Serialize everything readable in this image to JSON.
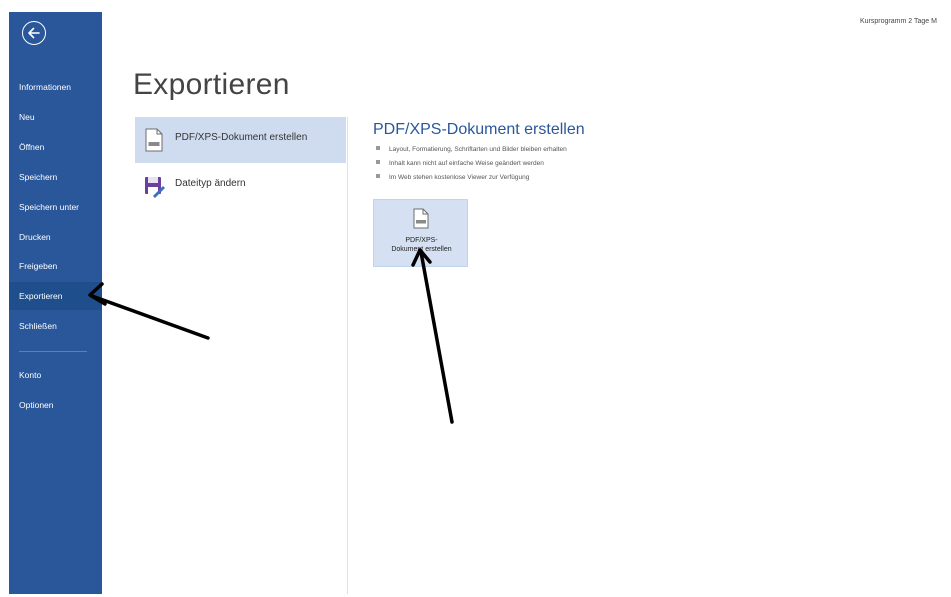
{
  "window": {
    "title_text": "Kursprogramm 2 Tage M"
  },
  "sidebar": {
    "back_icon": "back-arrow-icon",
    "items": [
      {
        "label": "Informationen"
      },
      {
        "label": "Neu"
      },
      {
        "label": "Öffnen"
      },
      {
        "label": "Speichern"
      },
      {
        "label": "Speichern unter"
      },
      {
        "label": "Drucken"
      },
      {
        "label": "Freigeben"
      },
      {
        "label": "Exportieren",
        "active": true
      },
      {
        "label": "Schließen"
      },
      {
        "label": "Konto"
      },
      {
        "label": "Optionen"
      }
    ],
    "colors": {
      "background": "#2a579a",
      "active": "#1e4e8c"
    }
  },
  "main": {
    "title": "Exportieren",
    "options": [
      {
        "label": "PDF/XPS-Dokument erstellen",
        "icon": "pdf-document-icon",
        "selected": true
      },
      {
        "label": "Dateityp ändern",
        "icon": "file-type-change-icon",
        "selected": false
      }
    ]
  },
  "detail": {
    "title": "PDF/XPS-Dokument erstellen",
    "bullets": [
      "Layout, Formatierung, Schriftarten und Bilder bleiben erhalten",
      "Inhalt kann nicht auf einfache Weise geändert werden",
      "Im Web stehen kostenlose Viewer zur Verfügung"
    ],
    "button": {
      "line1": "PDF/XPS-",
      "line2": "Dokument erstellen",
      "icon": "pdf-document-icon"
    }
  },
  "colors": {
    "accent": "#2b579a",
    "selected_option": "#cfdcef",
    "annotation_arrow": "#000000"
  }
}
